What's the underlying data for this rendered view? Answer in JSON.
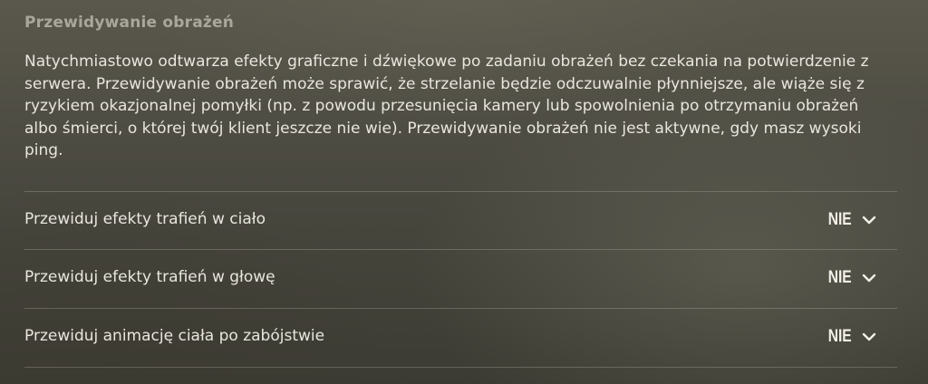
{
  "section": {
    "title": "Przewidywanie obrażeń",
    "description": "Natychmiastowo odtwarza efekty graficzne i dźwiękowe po zadaniu obrażeń bez czekania na potwierdzenie z serwera. Przewidywanie obrażeń może sprawić, że strzelanie będzie odczuwalnie płynniejsze, ale wiąże się z ryzykiem okazjonalnej pomyłki (np. z powodu przesunięcia kamery lub spowolnienia po otrzymaniu obrażeń albo śmierci, o której twój klient jeszcze nie wie). Przewidywanie obrażeń nie jest aktywne, gdy masz wysoki ping."
  },
  "settings": [
    {
      "label": "Przewiduj efekty trafień w ciało",
      "value": "NIE",
      "icon": "chevron-down-icon"
    },
    {
      "label": "Przewiduj efekty trafień w głowę",
      "value": "NIE",
      "icon": "chevron-down-icon"
    },
    {
      "label": "Przewiduj animację ciała po zabójstwie",
      "value": "NIE",
      "icon": "chevron-down-icon"
    }
  ],
  "colors": {
    "title": "#a9a79c",
    "text": "#e8e6de",
    "divider": "rgba(200,198,185,0.28)"
  }
}
